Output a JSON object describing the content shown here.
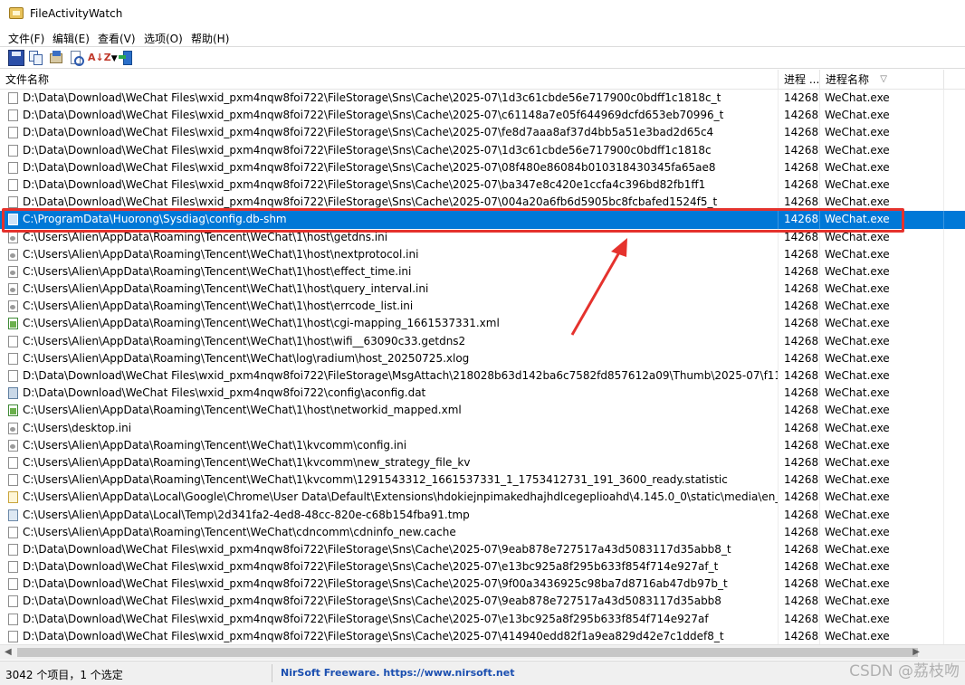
{
  "window": {
    "title": "FileActivityWatch"
  },
  "menu": [
    "文件(F)",
    "编辑(E)",
    "查看(V)",
    "选项(O)",
    "帮助(H)"
  ],
  "toolbar": {
    "sort_label": "A↓Z"
  },
  "columns": [
    "文件名称",
    "进程 ...",
    "进程名称"
  ],
  "sort_indicator": "▽",
  "rows": [
    {
      "name": "D:\\Data\\Download\\WeChat Files\\wxid_pxm4nqw8foi722\\FileStorage\\Sns\\Cache\\2025-07\\1d3c61cbde56e717900c0bdff1c1818c_t",
      "pid": "14268",
      "proc": "WeChat.exe",
      "icon": "file"
    },
    {
      "name": "D:\\Data\\Download\\WeChat Files\\wxid_pxm4nqw8foi722\\FileStorage\\Sns\\Cache\\2025-07\\c61148a7e05f644969dcfd653eb70996_t",
      "pid": "14268",
      "proc": "WeChat.exe",
      "icon": "file"
    },
    {
      "name": "D:\\Data\\Download\\WeChat Files\\wxid_pxm4nqw8foi722\\FileStorage\\Sns\\Cache\\2025-07\\fe8d7aaa8af37d4bb5a51e3bad2d65c4",
      "pid": "14268",
      "proc": "WeChat.exe",
      "icon": "file"
    },
    {
      "name": "D:\\Data\\Download\\WeChat Files\\wxid_pxm4nqw8foi722\\FileStorage\\Sns\\Cache\\2025-07\\1d3c61cbde56e717900c0bdff1c1818c",
      "pid": "14268",
      "proc": "WeChat.exe",
      "icon": "file"
    },
    {
      "name": "D:\\Data\\Download\\WeChat Files\\wxid_pxm4nqw8foi722\\FileStorage\\Sns\\Cache\\2025-07\\08f480e86084b010318430345fa65ae8",
      "pid": "14268",
      "proc": "WeChat.exe",
      "icon": "file"
    },
    {
      "name": "D:\\Data\\Download\\WeChat Files\\wxid_pxm4nqw8foi722\\FileStorage\\Sns\\Cache\\2025-07\\ba347e8c420e1ccfa4c396bd82fb1ff1",
      "pid": "14268",
      "proc": "WeChat.exe",
      "icon": "file"
    },
    {
      "name": "D:\\Data\\Download\\WeChat Files\\wxid_pxm4nqw8foi722\\FileStorage\\Sns\\Cache\\2025-07\\004a20a6fb6d5905bc8fcbafed1524f5_t",
      "pid": "14268",
      "proc": "WeChat.exe",
      "icon": "file"
    },
    {
      "name": "C:\\ProgramData\\Huorong\\Sysdiag\\config.db-shm",
      "pid": "14268",
      "proc": "WeChat.exe",
      "icon": "file",
      "selected": true
    },
    {
      "name": "C:\\Users\\Alien\\AppData\\Roaming\\Tencent\\WeChat\\1\\host\\getdns.ini",
      "pid": "14268",
      "proc": "WeChat.exe",
      "icon": "cfg"
    },
    {
      "name": "C:\\Users\\Alien\\AppData\\Roaming\\Tencent\\WeChat\\1\\host\\nextprotocol.ini",
      "pid": "14268",
      "proc": "WeChat.exe",
      "icon": "cfg"
    },
    {
      "name": "C:\\Users\\Alien\\AppData\\Roaming\\Tencent\\WeChat\\1\\host\\effect_time.ini",
      "pid": "14268",
      "proc": "WeChat.exe",
      "icon": "cfg"
    },
    {
      "name": "C:\\Users\\Alien\\AppData\\Roaming\\Tencent\\WeChat\\1\\host\\query_interval.ini",
      "pid": "14268",
      "proc": "WeChat.exe",
      "icon": "cfg"
    },
    {
      "name": "C:\\Users\\Alien\\AppData\\Roaming\\Tencent\\WeChat\\1\\host\\errcode_list.ini",
      "pid": "14268",
      "proc": "WeChat.exe",
      "icon": "cfg"
    },
    {
      "name": "C:\\Users\\Alien\\AppData\\Roaming\\Tencent\\WeChat\\1\\host\\cgi-mapping_1661537331.xml",
      "pid": "14268",
      "proc": "WeChat.exe",
      "icon": "xml"
    },
    {
      "name": "C:\\Users\\Alien\\AppData\\Roaming\\Tencent\\WeChat\\1\\host\\wifi__63090c33.getdns2",
      "pid": "14268",
      "proc": "WeChat.exe",
      "icon": "file"
    },
    {
      "name": "C:\\Users\\Alien\\AppData\\Roaming\\Tencent\\WeChat\\log\\radium\\host_20250725.xlog",
      "pid": "14268",
      "proc": "WeChat.exe",
      "icon": "file"
    },
    {
      "name": "D:\\Data\\Download\\WeChat Files\\wxid_pxm4nqw8foi722\\FileStorage\\MsgAttach\\218028b63d142ba6c7582fd857612a09\\Thumb\\2025-07\\f11...",
      "pid": "14268",
      "proc": "WeChat.exe",
      "icon": "file"
    },
    {
      "name": "D:\\Data\\Download\\WeChat Files\\wxid_pxm4nqw8foi722\\config\\aconfig.dat",
      "pid": "14268",
      "proc": "WeChat.exe",
      "icon": "dat"
    },
    {
      "name": "C:\\Users\\Alien\\AppData\\Roaming\\Tencent\\WeChat\\1\\host\\networkid_mapped.xml",
      "pid": "14268",
      "proc": "WeChat.exe",
      "icon": "xml"
    },
    {
      "name": "C:\\Users\\desktop.ini",
      "pid": "14268",
      "proc": "WeChat.exe",
      "icon": "cfg"
    },
    {
      "name": "C:\\Users\\Alien\\AppData\\Roaming\\Tencent\\WeChat\\1\\kvcomm\\config.ini",
      "pid": "14268",
      "proc": "WeChat.exe",
      "icon": "cfg"
    },
    {
      "name": "C:\\Users\\Alien\\AppData\\Roaming\\Tencent\\WeChat\\1\\kvcomm\\new_strategy_file_kv",
      "pid": "14268",
      "proc": "WeChat.exe",
      "icon": "file"
    },
    {
      "name": "C:\\Users\\Alien\\AppData\\Roaming\\Tencent\\WeChat\\1\\kvcomm\\1291543312_1661537331_1_1753412731_191_3600_ready.statistic",
      "pid": "14268",
      "proc": "WeChat.exe",
      "icon": "file"
    },
    {
      "name": "C:\\Users\\Alien\\AppData\\Local\\Google\\Chrome\\User Data\\Default\\Extensions\\hdokiejnpimakedhajhdlcegeplioahd\\4.145.0_0\\static\\media\\en_...",
      "pid": "14268",
      "proc": "WeChat.exe",
      "icon": "web"
    },
    {
      "name": "C:\\Users\\Alien\\AppData\\Local\\Temp\\2d341fa2-4ed8-48cc-820e-c68b154fba91.tmp",
      "pid": "14268",
      "proc": "WeChat.exe",
      "icon": "tmp"
    },
    {
      "name": "C:\\Users\\Alien\\AppData\\Roaming\\Tencent\\WeChat\\cdncomm\\cdninfo_new.cache",
      "pid": "14268",
      "proc": "WeChat.exe",
      "icon": "file"
    },
    {
      "name": "D:\\Data\\Download\\WeChat Files\\wxid_pxm4nqw8foi722\\FileStorage\\Sns\\Cache\\2025-07\\9eab878e727517a43d5083117d35abb8_t",
      "pid": "14268",
      "proc": "WeChat.exe",
      "icon": "file"
    },
    {
      "name": "D:\\Data\\Download\\WeChat Files\\wxid_pxm4nqw8foi722\\FileStorage\\Sns\\Cache\\2025-07\\e13bc925a8f295b633f854f714e927af_t",
      "pid": "14268",
      "proc": "WeChat.exe",
      "icon": "file"
    },
    {
      "name": "D:\\Data\\Download\\WeChat Files\\wxid_pxm4nqw8foi722\\FileStorage\\Sns\\Cache\\2025-07\\9f00a3436925c98ba7d8716ab47db97b_t",
      "pid": "14268",
      "proc": "WeChat.exe",
      "icon": "file"
    },
    {
      "name": "D:\\Data\\Download\\WeChat Files\\wxid_pxm4nqw8foi722\\FileStorage\\Sns\\Cache\\2025-07\\9eab878e727517a43d5083117d35abb8",
      "pid": "14268",
      "proc": "WeChat.exe",
      "icon": "file"
    },
    {
      "name": "D:\\Data\\Download\\WeChat Files\\wxid_pxm4nqw8foi722\\FileStorage\\Sns\\Cache\\2025-07\\e13bc925a8f295b633f854f714e927af",
      "pid": "14268",
      "proc": "WeChat.exe",
      "icon": "file"
    },
    {
      "name": "D:\\Data\\Download\\WeChat Files\\wxid_pxm4nqw8foi722\\FileStorage\\Sns\\Cache\\2025-07\\414940edd82f1a9ea829d42e7c1ddef8_t",
      "pid": "14268",
      "proc": "WeChat.exe",
      "icon": "file"
    }
  ],
  "status": {
    "count": "3042 个项目，1 个选定",
    "link": "NirSoft Freeware. https://www.nirsoft.net"
  },
  "watermark": "CSDN @荔枝吻",
  "colors": {
    "selection": "#0078d7",
    "annotation": "#e5322d",
    "link": "#1b4fb0"
  }
}
